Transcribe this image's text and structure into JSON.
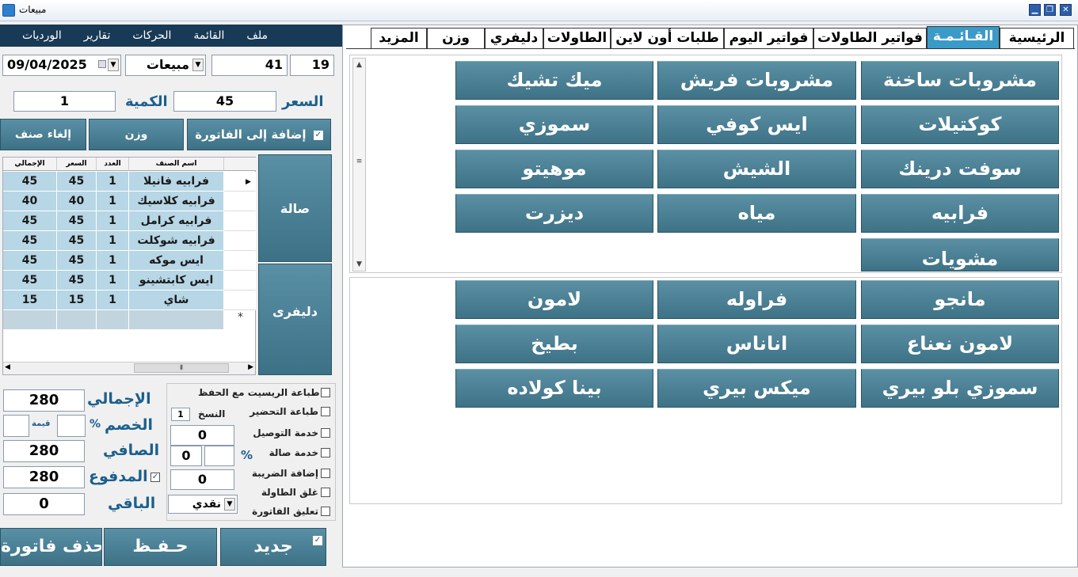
{
  "window": {
    "title": "مبيعات"
  },
  "menu": {
    "items": [
      "ملف",
      "القائمة",
      "الحركات",
      "تقارير",
      "الورديات"
    ]
  },
  "tabs": [
    "الرئيسية",
    "القـائـمـة",
    "فواتير الطاولات",
    "فواتير اليوم",
    "طلبات أون لاين",
    "الطاولات",
    "دليفري",
    "وزن",
    "المزيد"
  ],
  "categories": [
    "مشروبات ساخنة",
    "مشروبات فريش",
    "ميك تشيك",
    "كوكتيلات",
    "ايس كوفي",
    "سموزي",
    "سوفت درينك",
    "الشيش",
    "موهيتو",
    "فرابيه",
    "مياه",
    "ديزرت",
    "مشويات"
  ],
  "items": [
    "مانجو",
    "فراوله",
    "لامون",
    "لامون نعناع",
    "اناناس",
    "بطيخ",
    "سموزي بلو بيري",
    "ميكس بيري",
    "بينا كولاده"
  ],
  "header": {
    "date": "09/04/2025",
    "type": "مبيعات",
    "field_a": "41",
    "field_b": "19"
  },
  "entry": {
    "price_label": "السعر",
    "price": "45",
    "qty_label": "الكمية",
    "qty": "1"
  },
  "actions": {
    "add": "إضافة إلى الفاتورة",
    "weight": "وزن",
    "cancel": "إلغاء صنف"
  },
  "order_types": {
    "hall": "صالة",
    "delivery": "دليفرى"
  },
  "grid": {
    "headers": {
      "name": "اسم الصنف",
      "count": "العدد",
      "price": "السعر",
      "total": "الإجمالي"
    },
    "rows": [
      {
        "name": "فرابيه فانيلا",
        "count": "1",
        "price": "45",
        "total": "45"
      },
      {
        "name": "فرابيه كلاسيك",
        "count": "1",
        "price": "40",
        "total": "40"
      },
      {
        "name": "فرابيه كرامل",
        "count": "1",
        "price": "45",
        "total": "45"
      },
      {
        "name": "فرابيه شوكلت",
        "count": "1",
        "price": "45",
        "total": "45"
      },
      {
        "name": "ايس موكه",
        "count": "1",
        "price": "45",
        "total": "45"
      },
      {
        "name": "ايس كابتشينو",
        "count": "1",
        "price": "45",
        "total": "45"
      },
      {
        "name": "شاي",
        "count": "1",
        "price": "15",
        "total": "15"
      }
    ]
  },
  "options": {
    "print_receipt": "طباعة الريسيت مع الحفظ",
    "print_prep": "طباعة التحضير",
    "copies_label": "النسخ",
    "copies": "1",
    "delivery_service": "خدمة التوصيل",
    "delivery_value": "0",
    "hall_service": "خدمة صالة",
    "hall_percent": "%",
    "hall_value": "0",
    "add_tax": "إضافة الضريبة",
    "tax_value": "0",
    "close_table": "غلق الطاولة",
    "hold_invoice": "تعليق الفاتورة",
    "payment": "نقدي"
  },
  "summary": {
    "total_label": "الإجمالي",
    "total": "280",
    "discount_label": "الخصم",
    "discount_pct": "%",
    "discount_value_label": "قيمة",
    "net_label": "الصافي",
    "net": "280",
    "paid_label": "المدفوع",
    "paid": "280",
    "remaining_label": "الباقي",
    "remaining": "0"
  },
  "footer": {
    "new": "جديد",
    "save": "حـفـظ",
    "delete": "حذف فاتورة"
  },
  "colors": {
    "accent": "#3a9ac8",
    "button": "#4a7f94",
    "menubar": "#183a56",
    "grid_row": "#b7d6e6",
    "label": "#1c5f8c"
  }
}
